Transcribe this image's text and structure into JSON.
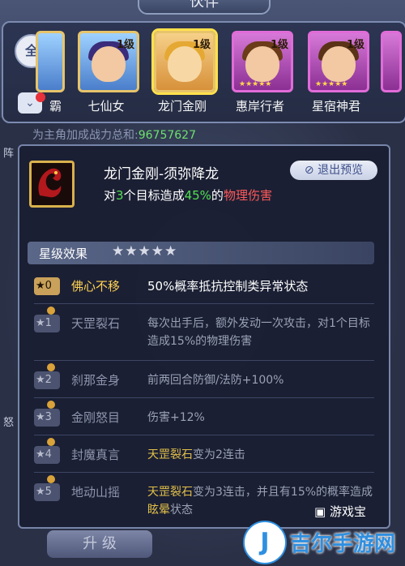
{
  "header": {
    "title": "伙伴"
  },
  "filter": {
    "all_label": "全",
    "arrow": "⌄"
  },
  "heroes": [
    {
      "name": "霸",
      "level": ""
    },
    {
      "name": "七仙女",
      "level": "1级"
    },
    {
      "name": "龙门金刚",
      "level": "1级"
    },
    {
      "name": "惠岸行者",
      "level": "1级"
    },
    {
      "name": "星宿神君",
      "level": "1级"
    }
  ],
  "power": {
    "label": "为主角加成战力总和:",
    "value": "96757627"
  },
  "side": {
    "left_chip": "阵",
    "left_chip2": "怒"
  },
  "skill": {
    "title": "龙门金刚-须弥降龙",
    "desc_pre": "对",
    "targets": "3",
    "desc_mid": "个目标造成",
    "percent": "45%",
    "desc_mid2": "的",
    "damage_type": "物理伤害",
    "exit_label": "退出预览"
  },
  "star_effects": {
    "header": "星级效果",
    "stars": "★★★★★",
    "rows": [
      {
        "star": "0",
        "name": "佛心不移",
        "text": "50%概率抵抗控制类异常状态",
        "active": true
      },
      {
        "star": "1",
        "name": "天罡裂石",
        "text": "每次出手后，额外发动一次攻击，对1个目标造成15%的物理伤害",
        "active": false
      },
      {
        "star": "2",
        "name": "刹那金身",
        "text": "前两回合防御/法防+100%",
        "active": false
      },
      {
        "star": "3",
        "name": "金刚怒目",
        "text": "伤害+12%",
        "active": false
      },
      {
        "star": "4",
        "name": "封魔真言",
        "text_hl": "天罡裂石",
        "text_rest": "变为2连击",
        "active": false
      },
      {
        "star": "5",
        "name": "地动山摇",
        "text_hl": "天罡裂石",
        "text_rest": "变为3连击，并且有15%的概率造成",
        "text_hl2": "眩晕",
        "text_end": "状态",
        "active": false
      }
    ]
  },
  "footer": {
    "upgrade_label": "升 级"
  },
  "watermarks": {
    "small": "游戏宝",
    "brand": "吉尔手游网",
    "logo": "J"
  }
}
